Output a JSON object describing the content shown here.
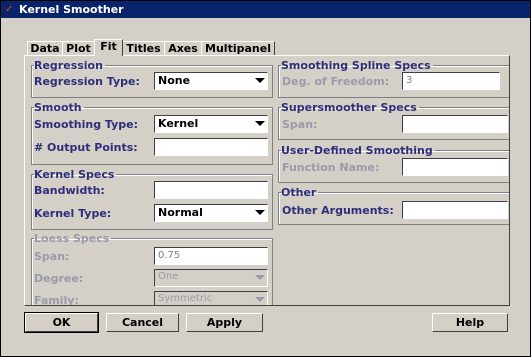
{
  "window": {
    "title": "Kernel Smoother"
  },
  "tabs": [
    "Data",
    "Plot",
    "Fit",
    "Titles",
    "Axes",
    "Multipanel"
  ],
  "regression": {
    "legend": "Regression",
    "type_label": "Regression Type:",
    "type_value": "None"
  },
  "smooth": {
    "legend": "Smooth",
    "type_label": "Smoothing Type:",
    "type_value": "Kernel",
    "points_label": "# Output Points:",
    "points_value": ""
  },
  "kernel": {
    "legend": "Kernel Specs",
    "bandwidth_label": "Bandwidth:",
    "bandwidth_value": "",
    "type_label": "Kernel Type:",
    "type_value": "Normal"
  },
  "loess": {
    "legend": "Loess Specs",
    "span_label": "Span:",
    "span_value": "0.75",
    "degree_label": "Degree:",
    "degree_value": "One",
    "family_label": "Family:",
    "family_value": "Symmetric"
  },
  "spline": {
    "legend": "Smoothing Spline Specs",
    "dof_label": "Deg. of Freedom:",
    "dof_value": "3"
  },
  "supersmoother": {
    "legend": "Supersmoother Specs",
    "span_label": "Span:",
    "span_value": ""
  },
  "userdef": {
    "legend": "User-Defined Smoothing",
    "fn_label": "Function Name:",
    "fn_value": ""
  },
  "other": {
    "legend": "Other",
    "args_label": "Other Arguments:",
    "args_value": ""
  },
  "buttons": {
    "ok": "OK",
    "cancel": "Cancel",
    "apply": "Apply",
    "help": "Help"
  }
}
